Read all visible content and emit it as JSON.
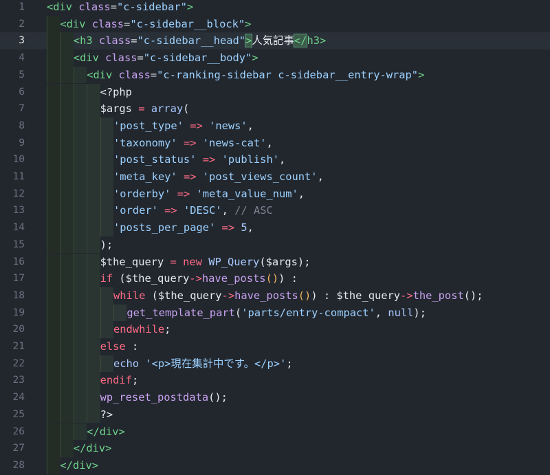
{
  "editor": {
    "current_line": 3,
    "line_numbers": [
      "1",
      "2",
      "3",
      "4",
      "5",
      "6",
      "7",
      "8",
      "9",
      "10",
      "11",
      "12",
      "13",
      "14",
      "15",
      "16",
      "17",
      "18",
      "19",
      "20",
      "21",
      "22",
      "23",
      "24",
      "25",
      "26",
      "27",
      "28"
    ],
    "lines": [
      [
        {
          "t": "tag",
          "v": "<div "
        },
        {
          "t": "attr",
          "v": "class"
        },
        {
          "t": "eq",
          "v": "="
        },
        {
          "t": "str",
          "v": "\"c-sidebar\""
        },
        {
          "t": "tag",
          "v": ">"
        }
      ],
      [
        {
          "t": "tag",
          "v": "<div "
        },
        {
          "t": "attr",
          "v": "class"
        },
        {
          "t": "eq",
          "v": "="
        },
        {
          "t": "str",
          "v": "\"c-sidebar__block\""
        },
        {
          "t": "tag",
          "v": ">"
        }
      ],
      [
        {
          "t": "tag",
          "v": "<h3 "
        },
        {
          "t": "attr",
          "v": "class"
        },
        {
          "t": "eq",
          "v": "="
        },
        {
          "t": "str",
          "v": "\"c-sidebar__head\""
        },
        {
          "t": "tag",
          "v": ">"
        },
        {
          "t": "txt",
          "v": "人気記事"
        },
        {
          "t": "tag",
          "v": "</"
        },
        {
          "t": "tag",
          "v": "h3"
        },
        {
          "t": "tag",
          "v": ">"
        }
      ],
      [
        {
          "t": "tag",
          "v": "<div "
        },
        {
          "t": "attr",
          "v": "class"
        },
        {
          "t": "eq",
          "v": "="
        },
        {
          "t": "str",
          "v": "\"c-sidebar__body\""
        },
        {
          "t": "tag",
          "v": ">"
        }
      ],
      [
        {
          "t": "tag",
          "v": "<div "
        },
        {
          "t": "attr",
          "v": "class"
        },
        {
          "t": "eq",
          "v": "="
        },
        {
          "t": "str",
          "v": "\"c-ranking-sidebar c-sidebar__entry-wrap\""
        },
        {
          "t": "tag",
          "v": ">"
        }
      ],
      [
        {
          "t": "plain",
          "v": "<?php"
        }
      ],
      [
        {
          "t": "var",
          "v": "$args "
        },
        {
          "t": "op",
          "v": "="
        },
        {
          "t": "plain",
          "v": " "
        },
        {
          "t": "fn2",
          "v": "array"
        },
        {
          "t": "plain",
          "v": "("
        }
      ],
      [
        {
          "t": "str",
          "v": "'post_type'"
        },
        {
          "t": "plain",
          "v": " "
        },
        {
          "t": "op",
          "v": "=>"
        },
        {
          "t": "plain",
          "v": " "
        },
        {
          "t": "str",
          "v": "'news'"
        },
        {
          "t": "plain",
          "v": ","
        }
      ],
      [
        {
          "t": "str",
          "v": "'taxonomy'"
        },
        {
          "t": "plain",
          "v": " "
        },
        {
          "t": "op",
          "v": "=>"
        },
        {
          "t": "plain",
          "v": " "
        },
        {
          "t": "str",
          "v": "'news-cat'"
        },
        {
          "t": "plain",
          "v": ","
        }
      ],
      [
        {
          "t": "str",
          "v": "'post_status'"
        },
        {
          "t": "plain",
          "v": " "
        },
        {
          "t": "op",
          "v": "=>"
        },
        {
          "t": "plain",
          "v": " "
        },
        {
          "t": "str",
          "v": "'publish'"
        },
        {
          "t": "plain",
          "v": ","
        }
      ],
      [
        {
          "t": "str",
          "v": "'meta_key'"
        },
        {
          "t": "plain",
          "v": " "
        },
        {
          "t": "op",
          "v": "=>"
        },
        {
          "t": "plain",
          "v": " "
        },
        {
          "t": "str",
          "v": "'post_views_count'"
        },
        {
          "t": "plain",
          "v": ","
        }
      ],
      [
        {
          "t": "str",
          "v": "'orderby'"
        },
        {
          "t": "plain",
          "v": " "
        },
        {
          "t": "op",
          "v": "=>"
        },
        {
          "t": "plain",
          "v": " "
        },
        {
          "t": "str",
          "v": "'meta_value_num'"
        },
        {
          "t": "plain",
          "v": ","
        }
      ],
      [
        {
          "t": "str",
          "v": "'order'"
        },
        {
          "t": "plain",
          "v": " "
        },
        {
          "t": "op",
          "v": "=>"
        },
        {
          "t": "plain",
          "v": " "
        },
        {
          "t": "str",
          "v": "'DESC'"
        },
        {
          "t": "plain",
          "v": ", "
        },
        {
          "t": "cmt",
          "v": "// ASC"
        }
      ],
      [
        {
          "t": "str",
          "v": "'posts_per_page'"
        },
        {
          "t": "plain",
          "v": " "
        },
        {
          "t": "op",
          "v": "=>"
        },
        {
          "t": "plain",
          "v": " "
        },
        {
          "t": "num",
          "v": "5"
        },
        {
          "t": "plain",
          "v": ","
        }
      ],
      [
        {
          "t": "plain",
          "v": ");"
        }
      ],
      [
        {
          "t": "var",
          "v": "$the_query "
        },
        {
          "t": "op",
          "v": "="
        },
        {
          "t": "plain",
          "v": " "
        },
        {
          "t": "kw",
          "v": "new"
        },
        {
          "t": "plain",
          "v": " "
        },
        {
          "t": "fn2",
          "v": "WP_Query"
        },
        {
          "t": "plain",
          "v": "($args);"
        }
      ],
      [
        {
          "t": "kw",
          "v": "if"
        },
        {
          "t": "plain",
          "v": " ($the_query"
        },
        {
          "t": "op",
          "v": "->"
        },
        {
          "t": "fn",
          "v": "have_posts"
        },
        {
          "t": "br1",
          "v": "()"
        },
        {
          "t": "plain",
          "v": ") :"
        }
      ],
      [
        {
          "t": "kw",
          "v": "while"
        },
        {
          "t": "plain",
          "v": " ($the_query"
        },
        {
          "t": "op",
          "v": "->"
        },
        {
          "t": "fn",
          "v": "have_posts"
        },
        {
          "t": "br1",
          "v": "()"
        },
        {
          "t": "plain",
          "v": ") : $the_query"
        },
        {
          "t": "op",
          "v": "->"
        },
        {
          "t": "fn",
          "v": "the_post"
        },
        {
          "t": "plain",
          "v": "();"
        }
      ],
      [
        {
          "t": "fn",
          "v": "get_template_part"
        },
        {
          "t": "plain",
          "v": "("
        },
        {
          "t": "str",
          "v": "'parts/entry-compact'"
        },
        {
          "t": "plain",
          "v": ", "
        },
        {
          "t": "num",
          "v": "null"
        },
        {
          "t": "plain",
          "v": ");"
        }
      ],
      [
        {
          "t": "kw",
          "v": "endwhile"
        },
        {
          "t": "plain",
          "v": ";"
        }
      ],
      [
        {
          "t": "kw",
          "v": "else"
        },
        {
          "t": "plain",
          "v": " :"
        }
      ],
      [
        {
          "t": "fn2",
          "v": "echo"
        },
        {
          "t": "plain",
          "v": " "
        },
        {
          "t": "str",
          "v": "'<p>現在集計中です。</p>'"
        },
        {
          "t": "plain",
          "v": ";"
        }
      ],
      [
        {
          "t": "kw",
          "v": "endif"
        },
        {
          "t": "plain",
          "v": ";"
        }
      ],
      [
        {
          "t": "fn",
          "v": "wp_reset_postdata"
        },
        {
          "t": "plain",
          "v": "();"
        }
      ],
      [
        {
          "t": "plain",
          "v": "?>"
        }
      ],
      [
        {
          "t": "tag",
          "v": "</div>"
        }
      ],
      [
        {
          "t": "tag",
          "v": "</div>"
        }
      ],
      [
        {
          "t": "tag",
          "v": "</div>"
        }
      ]
    ],
    "indents": [
      0,
      1,
      2,
      2,
      3,
      4,
      4,
      5,
      5,
      5,
      5,
      5,
      5,
      5,
      4,
      4,
      4,
      5,
      6,
      5,
      4,
      5,
      4,
      4,
      4,
      3,
      2,
      1
    ]
  }
}
